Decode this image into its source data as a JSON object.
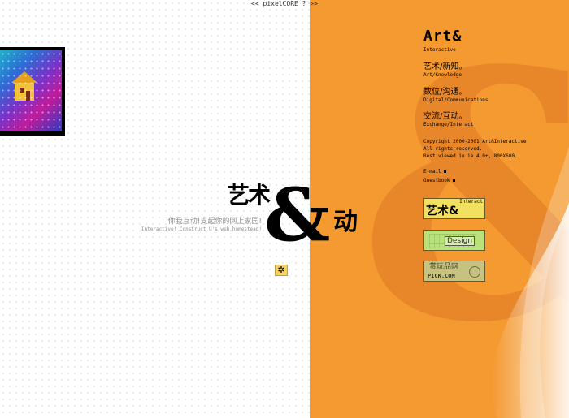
{
  "top_nav": {
    "label": "<< pixelCORE ? >>"
  },
  "logo": {
    "cn_left": "艺术",
    "cn_right": "动",
    "tagline_cn": "你我互动!支起你的网上家园!",
    "tagline_en": "Interactive! Construct U's web homestead!"
  },
  "brand": {
    "title": "Art&",
    "subtitle": "Interactive"
  },
  "menu": {
    "items": [
      {
        "cn": "艺术/新知。",
        "en": "Art/Knowledge"
      },
      {
        "cn": "数位/沟通。",
        "en": "Digital/Communications"
      },
      {
        "cn": "交流/互动。",
        "en": "Exchange/Interact"
      }
    ]
  },
  "copyright": {
    "line1": "Copyright 2000-2001 Art&Interactive",
    "line2": "All rights reserved.",
    "line3": "Best viewed in ie 4.0+, 800X600."
  },
  "links": {
    "email": "E-mail",
    "guestbook": "Guestbook"
  },
  "buttons": {
    "interact": {
      "small": "Interact",
      "big": "艺术&"
    },
    "design": {
      "label": "Design"
    },
    "pick": {
      "cn": "赏玩品网",
      "en": "PICK.COM"
    }
  },
  "colors": {
    "orange": "#f49a31",
    "amp_shadow": "#e8862a",
    "button_yellow": "#f2e061",
    "button_green": "#b9e27b",
    "button_olive": "#c7c27f"
  },
  "icons": {
    "flower": "flower-icon"
  }
}
